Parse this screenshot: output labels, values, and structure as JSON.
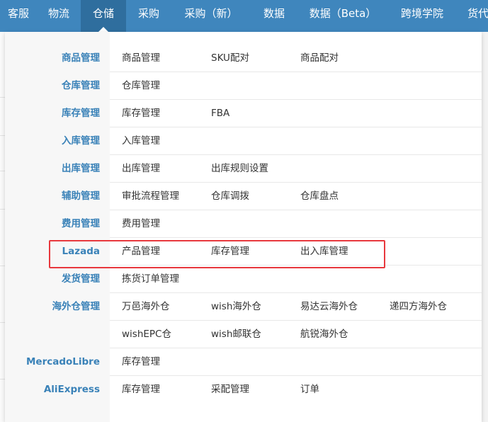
{
  "nav": {
    "items": [
      {
        "label": "客服"
      },
      {
        "label": "物流"
      },
      {
        "label": "仓储"
      },
      {
        "label": "采购"
      },
      {
        "label": "采购（新）"
      },
      {
        "label": "数据"
      },
      {
        "label": "数据（Beta）"
      },
      {
        "label": "跨境学院"
      },
      {
        "label": "货代"
      }
    ],
    "active_index": 2,
    "color": "#3f86bd",
    "active_color": "#2f6e9e"
  },
  "menu": {
    "highlight_color": "#e8383d",
    "category_color": "#3a82b8",
    "rows": [
      {
        "category": "商品管理",
        "links": [
          "商品管理",
          "SKU配对",
          "商品配对"
        ]
      },
      {
        "category": "仓库管理",
        "links": [
          "仓库管理"
        ]
      },
      {
        "category": "库存管理",
        "links": [
          "库存管理",
          "FBA"
        ]
      },
      {
        "category": "入库管理",
        "links": [
          "入库管理"
        ]
      },
      {
        "category": "出库管理",
        "links": [
          "出库管理",
          "出库规则设置"
        ]
      },
      {
        "category": "辅助管理",
        "links": [
          "审批流程管理",
          "仓库调拨",
          "仓库盘点"
        ]
      },
      {
        "category": "费用管理",
        "links": [
          "费用管理"
        ]
      },
      {
        "category": "Lazada",
        "links": [
          "产品管理",
          "库存管理",
          "出入库管理"
        ]
      },
      {
        "category": "发货管理",
        "links": [
          "拣货订单管理"
        ]
      },
      {
        "category": "海外仓管理",
        "links": [
          "万邑海外仓",
          "wish海外仓",
          "易达云海外仓",
          "递四方海外仓"
        ]
      },
      {
        "category": "",
        "links": [
          "wishEPC仓",
          "wish邮联仓",
          "航锐海外仓"
        ]
      },
      {
        "category": "MercadoLibre",
        "links": [
          "库存管理"
        ]
      },
      {
        "category": "AliExpress",
        "links": [
          "库存管理",
          "采配管理",
          "订单"
        ]
      }
    ]
  }
}
